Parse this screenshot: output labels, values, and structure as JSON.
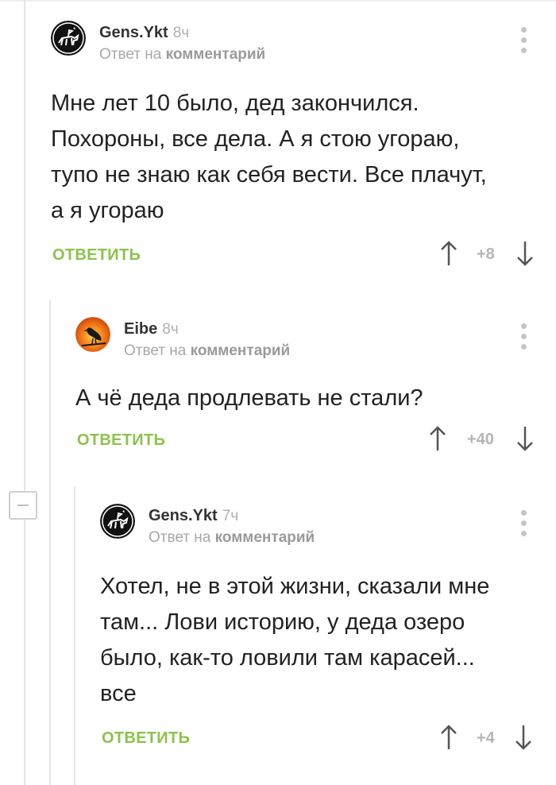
{
  "comments": [
    {
      "author": "Gens.Ykt",
      "time": "8ч",
      "reply_prefix": "Ответ на",
      "reply_target": "комментарий",
      "lines": [
        "Мне лет 10 было, дед закончился.",
        "Похороны, все дела. А я стою угораю,",
        "тупо не знаю как себя вести. Все плачут,",
        "а я угораю"
      ],
      "reply_label": "ОТВЕТИТЬ",
      "score": "+8"
    },
    {
      "author": "Eibe",
      "time": "8ч",
      "reply_prefix": "Ответ на",
      "reply_target": "комментарий",
      "lines": [
        "А чё деда продлевать не стали?"
      ],
      "reply_label": "ОТВЕТИТЬ",
      "score": "+40"
    },
    {
      "author": "Gens.Ykt",
      "time": "7ч",
      "reply_prefix": "Ответ на",
      "reply_target": "комментарий",
      "lines": [
        "Хотел, не в этой жизни, сказали мне",
        "там... Лови историю, у деда озеро",
        "было, как-то ловили там карасей...",
        "все"
      ],
      "reply_label": "ОТВЕТИТЬ",
      "score": "+4"
    }
  ],
  "colors": {
    "reply_green": "#8bc34a",
    "meta_gray": "#a8a8a8"
  }
}
